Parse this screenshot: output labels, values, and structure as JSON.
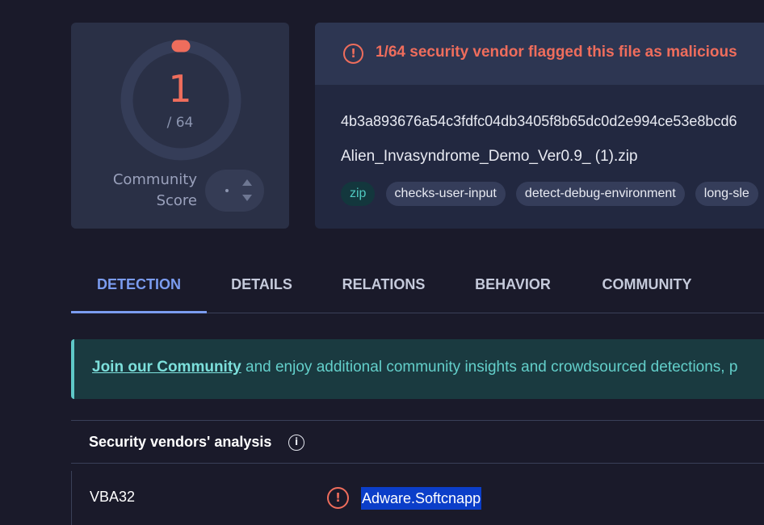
{
  "score": {
    "detections": "1",
    "total": "/ 64",
    "community_label_line1": "Community",
    "community_label_line2": "Score",
    "vote_value": "·"
  },
  "file": {
    "alert": "1/64 security vendor flagged this file as malicious",
    "hash": "4b3a893676a54c3fdfc04db3405f8b65dc0d2e994ce53e8bcd6",
    "name": "Alien_Invasyndrome_Demo_Ver0.9_ (1).zip",
    "tags": [
      "zip",
      "checks-user-input",
      "detect-debug-environment",
      "long-sle"
    ]
  },
  "tabs": [
    "DETECTION",
    "DETAILS",
    "RELATIONS",
    "BEHAVIOR",
    "COMMUNITY"
  ],
  "banner": {
    "link": "Join our Community",
    "text": " and enjoy additional community insights and crowdsourced detections, p"
  },
  "analysis": {
    "title": "Security vendors' analysis",
    "info_icon": "i",
    "rows": [
      {
        "vendor": "VBA32",
        "result": "Adware.Softcnapp"
      }
    ]
  },
  "icons": {
    "alert": "!"
  },
  "colors": {
    "malicious": "#ef6d5c",
    "accent": "#7b9cf0",
    "banner_text": "#63cfca",
    "background": "#1a1a2a",
    "selection": "#0b3ec9"
  }
}
